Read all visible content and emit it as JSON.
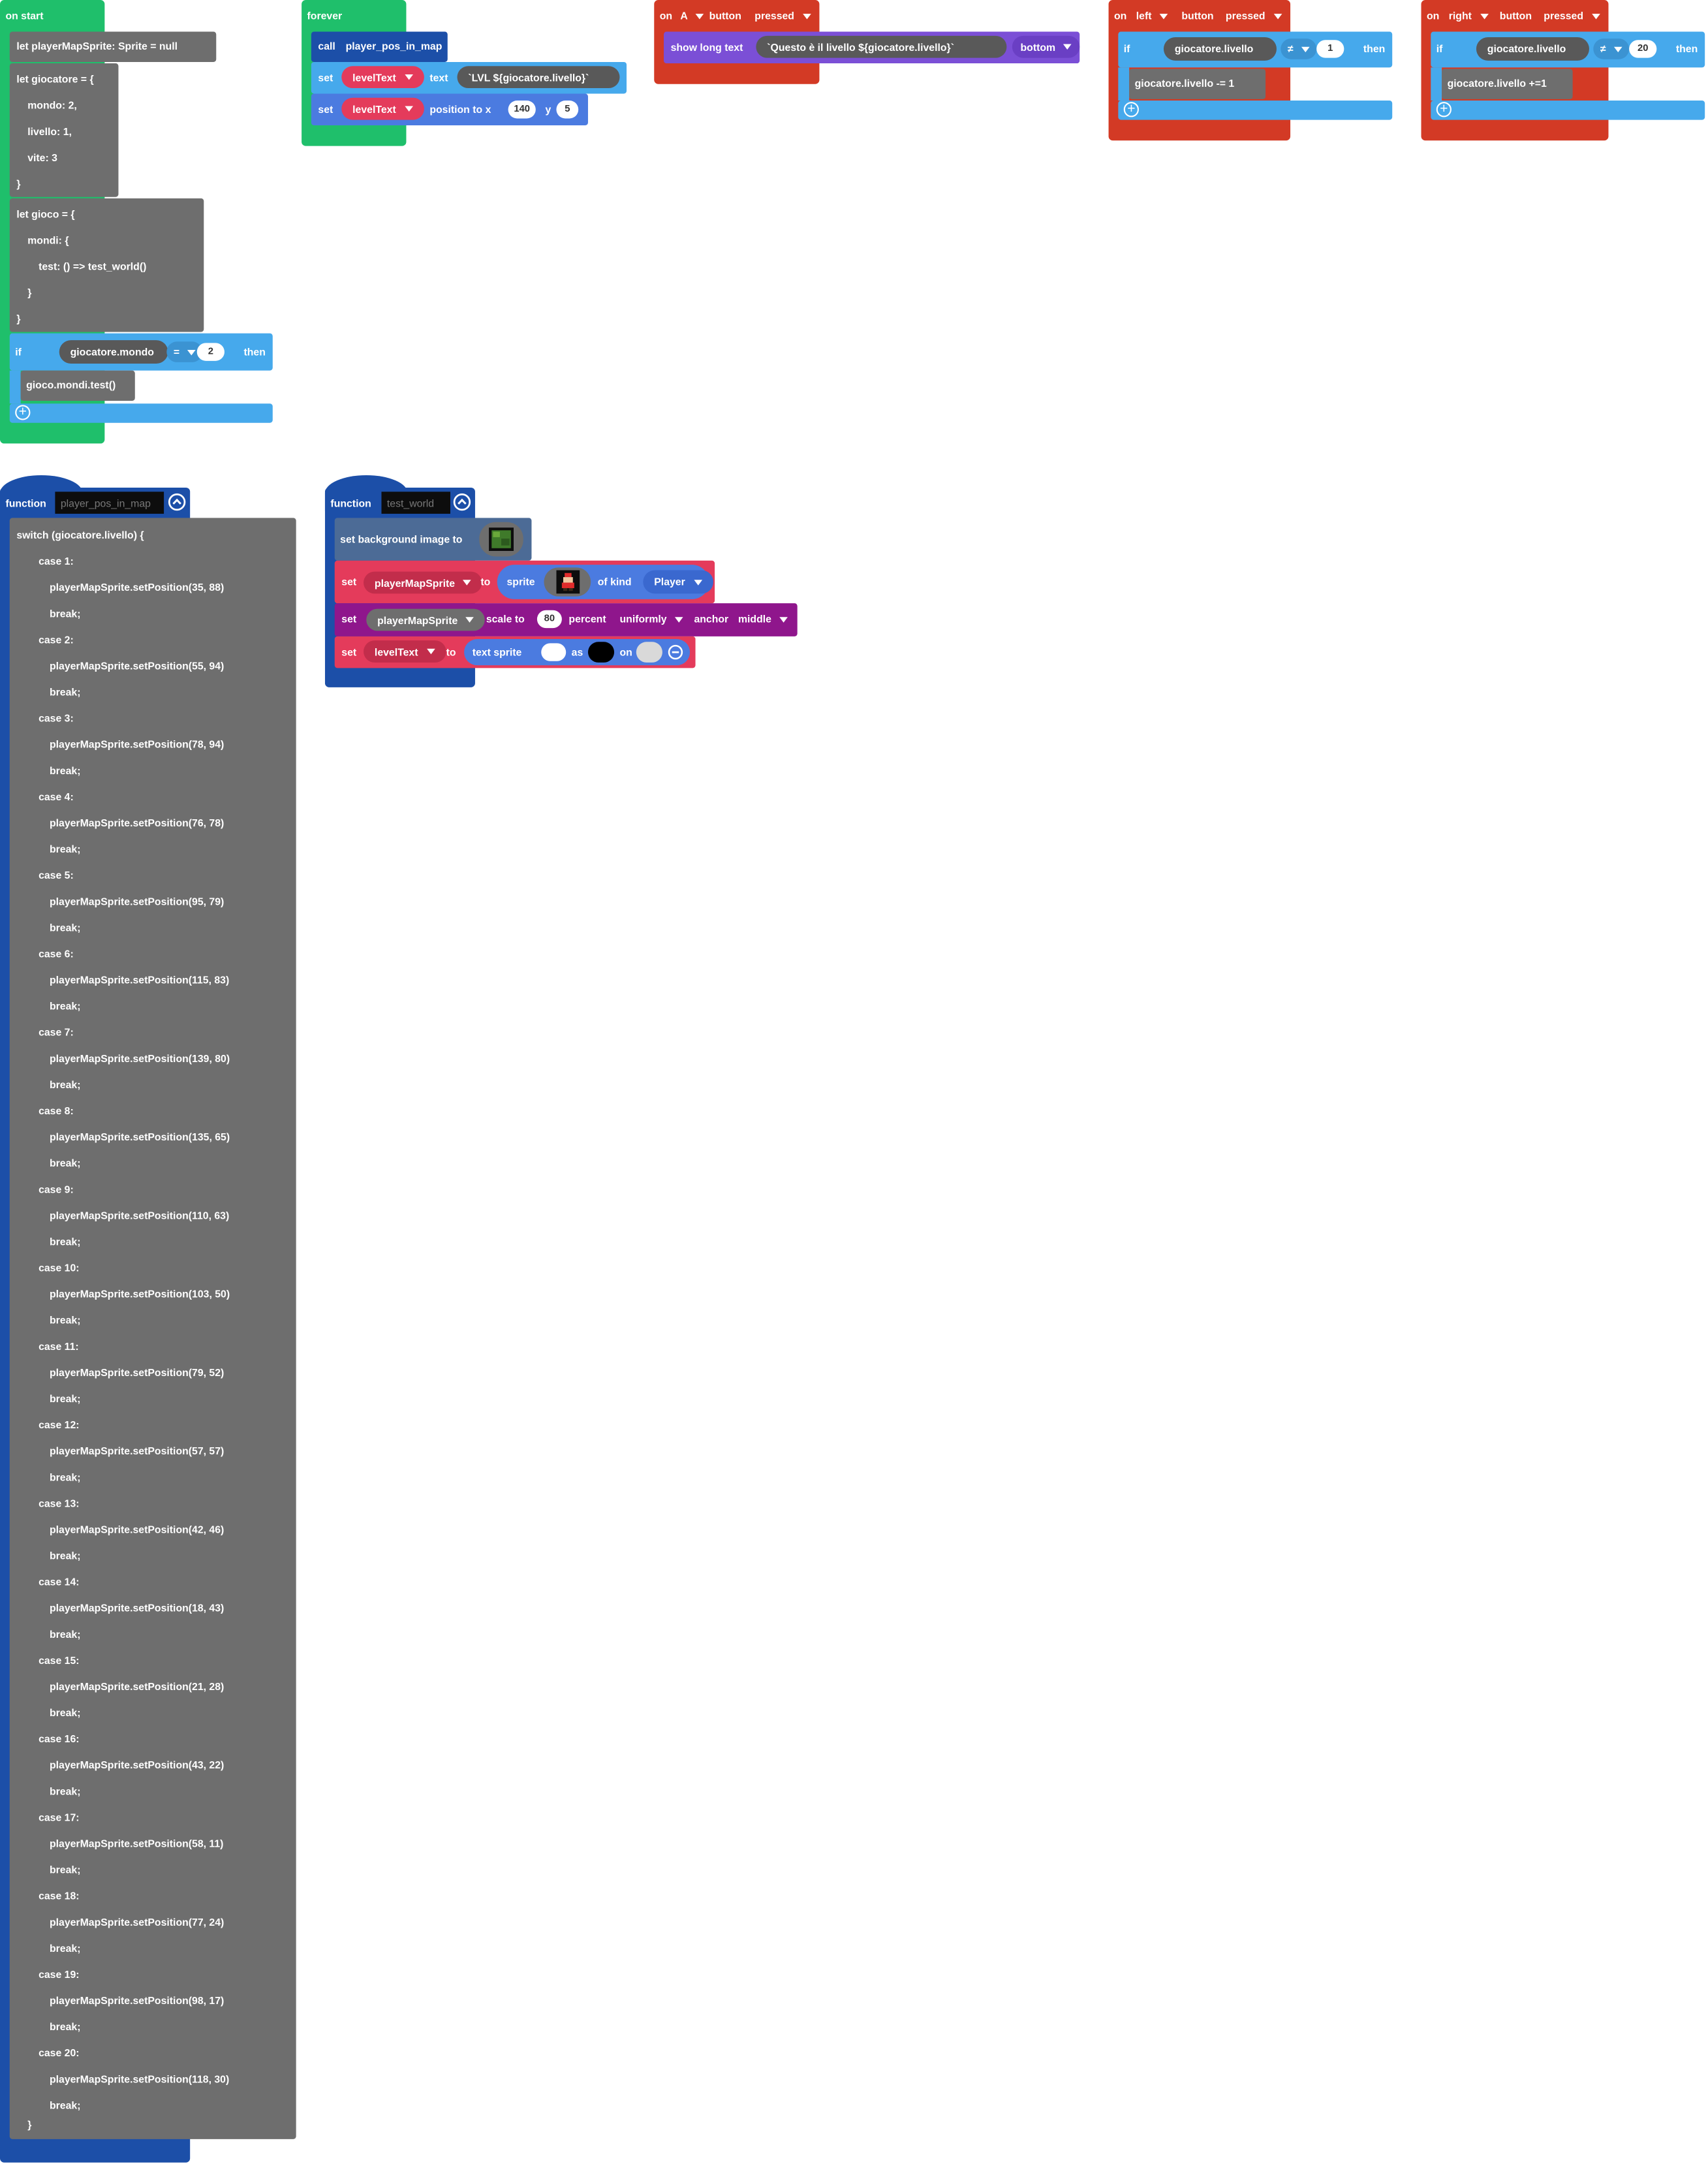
{
  "on_start": {
    "header": "on start",
    "let_sprite": "let playerMapSprite: Sprite = null",
    "giocatore_lines": [
      "let giocatore = {",
      "mondo: 2,",
      "livello: 1,",
      "vite: 3",
      "}"
    ],
    "gioco_lines": [
      "let gioco = {",
      "mondi: {",
      "test: () => test_world()",
      "}",
      "}"
    ],
    "if_kw": "if",
    "if_var": "giocatore.mondo",
    "if_op": "=",
    "if_val": "2",
    "then_kw": "then",
    "if_body": "gioco.mondi.test()"
  },
  "forever": {
    "header": "forever",
    "call_kw": "call",
    "call_fn": "player_pos_in_map",
    "set1_kw": "set",
    "set1_var": "levelText",
    "set1_prop": "text",
    "set1_val": "`LVL ${giocatore.livello}`",
    "set2_kw": "set",
    "set2_var": "levelText",
    "set2_prop": "position to x",
    "set2_x": "140",
    "set2_y_kw": "y",
    "set2_y": "5"
  },
  "on_a": {
    "on_kw": "on",
    "button_name": "A",
    "button_kw": "button",
    "event": "pressed",
    "show_kw": "show long text",
    "text": "`Questo è il livello ${giocatore.livello}`",
    "position": "bottom"
  },
  "on_left": {
    "on_kw": "on",
    "button_name": "left",
    "button_kw": "button",
    "event": "pressed",
    "if_kw": "if",
    "if_var": "giocatore.livello",
    "if_op": "≠",
    "if_val": "1",
    "then_kw": "then",
    "body": "giocatore.livello -= 1"
  },
  "on_right": {
    "on_kw": "on",
    "button_name": "right",
    "button_kw": "button",
    "event": "pressed",
    "if_kw": "if",
    "if_var": "giocatore.livello",
    "if_op": "≠",
    "if_val": "20",
    "then_kw": "then",
    "body": "giocatore.livello +=1"
  },
  "fn_player_pos": {
    "kw": "function",
    "name": "player_pos_in_map",
    "switch_line": "switch (giocatore.livello) {",
    "cases": [
      {
        "label": "case 1:",
        "call": "playerMapSprite.setPosition(35, 88)",
        "brk": "break;"
      },
      {
        "label": "case 2:",
        "call": "playerMapSprite.setPosition(55, 94)",
        "brk": "break;"
      },
      {
        "label": "case 3:",
        "call": "playerMapSprite.setPosition(78, 94)",
        "brk": "break;"
      },
      {
        "label": "case 4:",
        "call": "playerMapSprite.setPosition(76, 78)",
        "brk": "break;"
      },
      {
        "label": "case 5:",
        "call": "playerMapSprite.setPosition(95, 79)",
        "brk": "break;"
      },
      {
        "label": "case 6:",
        "call": "playerMapSprite.setPosition(115, 83)",
        "brk": "break;"
      },
      {
        "label": "case 7:",
        "call": "playerMapSprite.setPosition(139, 80)",
        "brk": "break;"
      },
      {
        "label": "case 8:",
        "call": "playerMapSprite.setPosition(135, 65)",
        "brk": "break;"
      },
      {
        "label": "case 9:",
        "call": "playerMapSprite.setPosition(110, 63)",
        "brk": "break;"
      },
      {
        "label": "case 10:",
        "call": "playerMapSprite.setPosition(103, 50)",
        "brk": "break;"
      },
      {
        "label": "case 11:",
        "call": "playerMapSprite.setPosition(79, 52)",
        "brk": "break;"
      },
      {
        "label": "case 12:",
        "call": "playerMapSprite.setPosition(57, 57)",
        "brk": "break;"
      },
      {
        "label": "case 13:",
        "call": "playerMapSprite.setPosition(42, 46)",
        "brk": "break;"
      },
      {
        "label": "case 14:",
        "call": "playerMapSprite.setPosition(18, 43)",
        "brk": "break;"
      },
      {
        "label": "case 15:",
        "call": "playerMapSprite.setPosition(21, 28)",
        "brk": "break;"
      },
      {
        "label": "case 16:",
        "call": "playerMapSprite.setPosition(43, 22)",
        "brk": "break;"
      },
      {
        "label": "case 17:",
        "call": "playerMapSprite.setPosition(58, 11)",
        "brk": "break;"
      },
      {
        "label": "case 18:",
        "call": "playerMapSprite.setPosition(77, 24)",
        "brk": "break;"
      },
      {
        "label": "case 19:",
        "call": "playerMapSprite.setPosition(98, 17)",
        "brk": "break;"
      },
      {
        "label": "case 20:",
        "call": "playerMapSprite.setPosition(118, 30)",
        "brk": "break;"
      }
    ],
    "close": "}"
  },
  "fn_test_world": {
    "kw": "function",
    "name": "test_world",
    "bg_kw": "set background image to",
    "sprite_set_kw": "set",
    "sprite_var": "playerMapSprite",
    "sprite_to_kw": "to",
    "sprite_kw": "sprite",
    "of_kind_kw": "of kind",
    "kind": "Player",
    "scale_set_kw": "set",
    "scale_var": "playerMapSprite",
    "scale_kw": "scale to",
    "scale_val": "80",
    "percent_kw": "percent",
    "scale_mode": "uniformly",
    "anchor_kw": "anchor",
    "anchor_val": "middle",
    "text_set_kw": "set",
    "text_var": "levelText",
    "text_to_kw": "to",
    "text_sprite_kw": "text sprite",
    "text_as_kw": "as",
    "text_on_kw": "on"
  },
  "colors": {
    "events_green": "#1fbf6b",
    "controller_red": "#d33a25",
    "logic_blue": "#46a9ec",
    "functions_blue": "#1c4fa8",
    "sprites_red": "#e43b5b",
    "scene_slate": "#4c6b96",
    "text_purple": "#7b4fd6",
    "scaling_magenta": "#8f168c",
    "code_gray": "#6e6e6e"
  }
}
